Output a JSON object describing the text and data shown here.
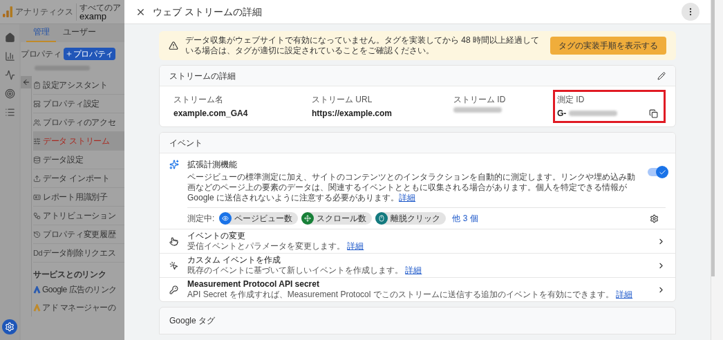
{
  "app": {
    "product": "アナリティクス",
    "account_label": "すべてのア",
    "account_name": "examp",
    "tabs": [
      {
        "label": "管理",
        "selected": true
      },
      {
        "label": "ユーザー",
        "selected": false
      }
    ],
    "property_label": "プロパティ",
    "create_button": "プロパティ",
    "nav": [
      {
        "label": "設定アシスタント",
        "selected": false
      },
      {
        "label": "プロパティ設定",
        "selected": false
      },
      {
        "label": "プロパティのアクセ",
        "selected": false
      },
      {
        "label": "データ ストリーム",
        "selected": true
      },
      {
        "label": "データ設定",
        "selected": false
      },
      {
        "label": "データ インポート",
        "selected": false
      },
      {
        "label": "レポート用識別子",
        "selected": false
      },
      {
        "label": "アトリビューション",
        "selected": false
      },
      {
        "label": "プロパティ変更履歴",
        "selected": false
      },
      {
        "label": "データ削除リクエス",
        "selected": false,
        "icon_text": "Dd"
      }
    ],
    "links_heading": "サービスとのリンク",
    "links": [
      "Google 広告のリンク",
      "アド マネージャーの"
    ]
  },
  "panel": {
    "title": "ウェブ ストリームの詳細",
    "alert": {
      "message": "データ収集がウェブサイトで有効になっていません。タグを実装してから 48 時間以上経過している場合は、タグが適切に設定されていることをご確認ください。",
      "button": "タグの実装手順を表示する"
    },
    "stream_details": {
      "title": "ストリームの詳細",
      "fields": [
        {
          "label": "ストリーム名",
          "kind": "text",
          "value": "example.com_GA4",
          "highlighted": false
        },
        {
          "label": "ストリーム URL",
          "kind": "text",
          "value": "https://example.com",
          "highlighted": false
        },
        {
          "label": "ストリーム ID",
          "kind": "redacted",
          "highlighted": false
        },
        {
          "label": "測定 ID",
          "kind": "redacted",
          "prefix": "G-",
          "highlighted": true
        }
      ]
    },
    "events": {
      "title": "イベント",
      "enhanced": {
        "title": "拡張計測機能",
        "description": "ページビューの標準測定に加え、サイトのコンテンツとのインタラクションを自動的に測定します。リンクや埋め込み動画などのページ上の要素のデータは、関連するイベントとともに収集される場合があります。個人を特定できる情報が Google に送信されないように注意する必要があります。",
        "link": "詳細",
        "on": true,
        "measuring_label": "測定中:",
        "chips": [
          {
            "label": "ページビュー数",
            "color": "#1a73e8"
          },
          {
            "label": "スクロール数",
            "color": "#188038"
          },
          {
            "label": "離脱クリック",
            "color": "#137a7f"
          }
        ],
        "more": "他 3 個"
      },
      "rows": [
        {
          "title": "イベントの変更",
          "description": "受信イベントとパラメータを変更します。",
          "link": "詳細",
          "bold": false
        },
        {
          "title": "カスタム イベントを作成",
          "description": "既存のイベントに基づいて新しいイベントを作成します。",
          "link": "詳細",
          "bold": false
        },
        {
          "title": "Measurement Protocol API secret",
          "description": "API Secret を作成すれば、Measurement Protocol でこのストリームに送信する追加のイベントを有効にできます。",
          "link": "詳細",
          "bold": true
        }
      ]
    },
    "google_tag": {
      "title": "Google タグ"
    }
  }
}
